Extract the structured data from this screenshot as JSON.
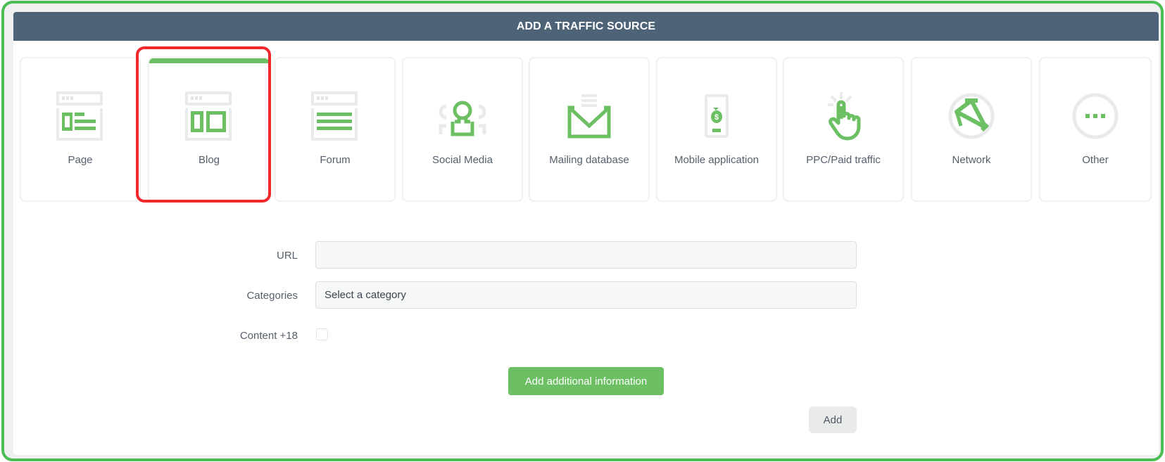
{
  "panel": {
    "title": "ADD A TRAFFIC SOURCE"
  },
  "colors": {
    "accent_green": "#6cbf62",
    "header_bg": "#4e6278",
    "icon_gray": "#e9eaec",
    "highlight_red": "#f2282b",
    "frame_green": "#4cbc55"
  },
  "source_types": [
    {
      "label": "Page",
      "icon": "page-layout-icon",
      "selected": false
    },
    {
      "label": "Blog",
      "icon": "blog-layout-icon",
      "selected": true
    },
    {
      "label": "Forum",
      "icon": "forum-lines-icon",
      "selected": false
    },
    {
      "label": "Social Media",
      "icon": "social-people-icon",
      "selected": false
    },
    {
      "label": "Mailing database",
      "icon": "envelope-icon",
      "selected": false
    },
    {
      "label": "Mobile application",
      "icon": "mobile-money-icon",
      "selected": false
    },
    {
      "label": "PPC/Paid traffic",
      "icon": "pointer-click-icon",
      "selected": false
    },
    {
      "label": "Network",
      "icon": "network-icon",
      "selected": false
    },
    {
      "label": "Other",
      "icon": "ellipsis-icon",
      "selected": false
    }
  ],
  "form": {
    "url": {
      "label": "URL",
      "value": "",
      "placeholder": ""
    },
    "categories": {
      "label": "Categories",
      "selected": "Select a category"
    },
    "adult_content": {
      "label": "Content +18",
      "checked": false
    },
    "additional_info_button": "Add additional information",
    "add_button": "Add"
  }
}
